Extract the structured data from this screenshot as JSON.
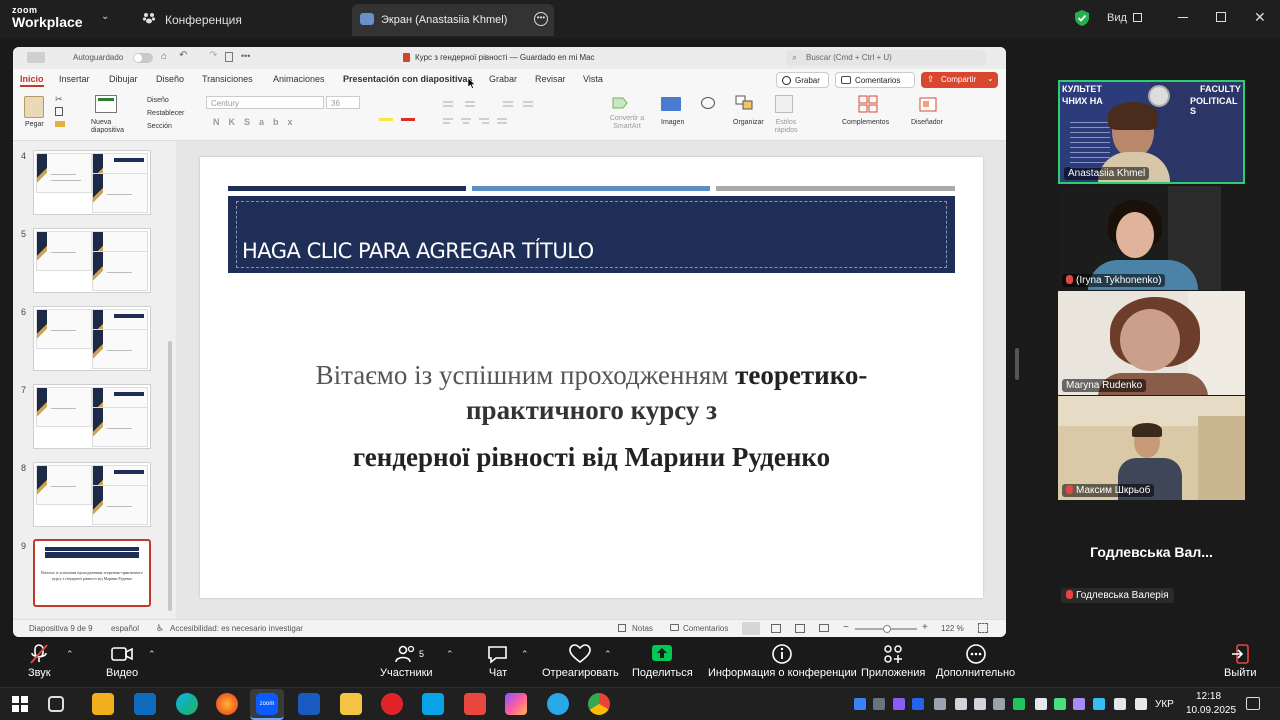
{
  "zoom": {
    "logo_line1": "zoom",
    "logo_line2": "Workplace",
    "meeting_tab": "Конференция",
    "screen_tab": "Экран (Anastasiia Khmel)",
    "view_label": "Вид"
  },
  "ppt": {
    "autosave": "Autoguardado",
    "doc_title": "Курс з гендерної рівності — Guardado en mi Mac",
    "search_placeholder": "Buscar (Cmd + Ctrl + U)",
    "menu": [
      "Inicio",
      "Insertar",
      "Dibujar",
      "Diseño",
      "Transiciones",
      "Animaciones",
      "Presentación con diapositivas",
      "Grabar",
      "Revisar",
      "Vista"
    ],
    "record_btn": "Grabar",
    "comments_btn": "Comentarios",
    "share_btn": "Compartir",
    "ribbon": {
      "paste": "Pegar",
      "new_slide": "Nueva diapositiva",
      "design": "Diseño",
      "reset": "Restablecer",
      "section": "Sección",
      "font": "Century",
      "size": "36",
      "convert_smartart": "Convertir a SmartArt",
      "image": "Imagen",
      "organize": "Organizar",
      "quick_styles": "Estilos rápidos",
      "addins": "Complementos",
      "designer": "Diseñador"
    },
    "thumbs": [
      {
        "num": "4"
      },
      {
        "num": "5"
      },
      {
        "num": "6"
      },
      {
        "num": "7"
      },
      {
        "num": "8"
      },
      {
        "num": "9"
      }
    ],
    "thumb9_text": "Вітаємо із успішним проходженням теоретико-практичного курсу з гендерної рівності від Марини Руденко",
    "slide": {
      "title": "HAGA CLIC PARA AGREGAR TÍTULO",
      "line1_plain": "Вітаємо із успішним проходженням ",
      "line1_bold": "теоретико-",
      "line2": "практичного курсу з",
      "line3": "гендерної рівності від Марини Руденко"
    },
    "status": {
      "slide_pos": "Diapositiva 9 de 9",
      "language": "español",
      "accessibility": "Accesibilidad: es necesario investigar",
      "notes": "Notas",
      "comments": "Comentarios",
      "zoom": "122 %"
    }
  },
  "participants": [
    {
      "name": "Anastasiia Khmel",
      "muted": false
    },
    {
      "name": "(Iryna Tykhonenko)",
      "muted": true
    },
    {
      "name": "Maryna Rudenko",
      "muted": false
    },
    {
      "name": "Максим Шкрьоб",
      "muted": true
    }
  ],
  "banner_bg1": "КУЛЬТЕТ",
  "banner_bg2": "ЧНИХ НА",
  "banner_bg3": "FACULTY",
  "banner_bg4": "POLITICAL S",
  "audio_only": {
    "big_name": "Годлевська  Вал...",
    "label": "Годлевська Валерія"
  },
  "toolbar": {
    "audio": "Звук",
    "video": "Видео",
    "participants": "Участники",
    "participants_count": "5",
    "chat": "Чат",
    "react": "Отреагировать",
    "share": "Поделиться",
    "info": "Информация о конференции",
    "apps": "Приложения",
    "more": "Дополнительно",
    "leave": "Выйти"
  },
  "taskbar": {
    "lang": "УКР",
    "time": "12:18",
    "date": "10.09.2025"
  },
  "colors": {
    "slide_navy": "#1f2e56",
    "share_red": "#d9482e",
    "zoom_green": "#00c853",
    "active_speaker": "#2ecc71"
  }
}
